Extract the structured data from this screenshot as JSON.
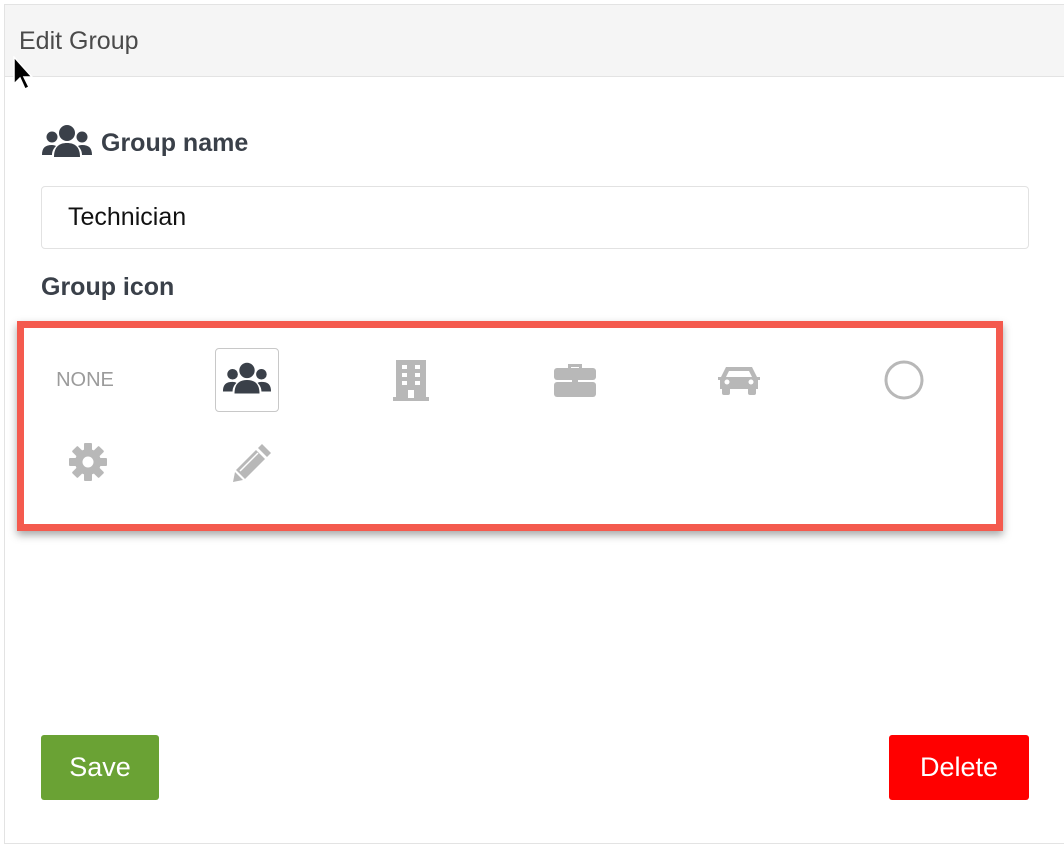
{
  "panel": {
    "title": "Edit Group"
  },
  "group_name": {
    "label": "Group name",
    "icon": "users-icon",
    "value": "Technician"
  },
  "group_icon": {
    "label": "Group icon",
    "selected": "users",
    "options": [
      {
        "id": "none",
        "label": "NONE"
      },
      {
        "id": "users",
        "icon": "users-icon"
      },
      {
        "id": "building",
        "icon": "building-icon"
      },
      {
        "id": "briefcase",
        "icon": "briefcase-icon"
      },
      {
        "id": "car",
        "icon": "car-icon"
      },
      {
        "id": "circle",
        "icon": "circle-icon"
      },
      {
        "id": "gear",
        "icon": "gear-icon"
      },
      {
        "id": "pencil",
        "icon": "pencil-icon"
      }
    ]
  },
  "actions": {
    "save_label": "Save",
    "delete_label": "Delete"
  },
  "colors": {
    "highlight_border": "#f45a4e",
    "save": "#6aa234",
    "delete": "#ff0000",
    "icon_inactive": "#b8b8b8",
    "icon_active": "#3a4049"
  }
}
